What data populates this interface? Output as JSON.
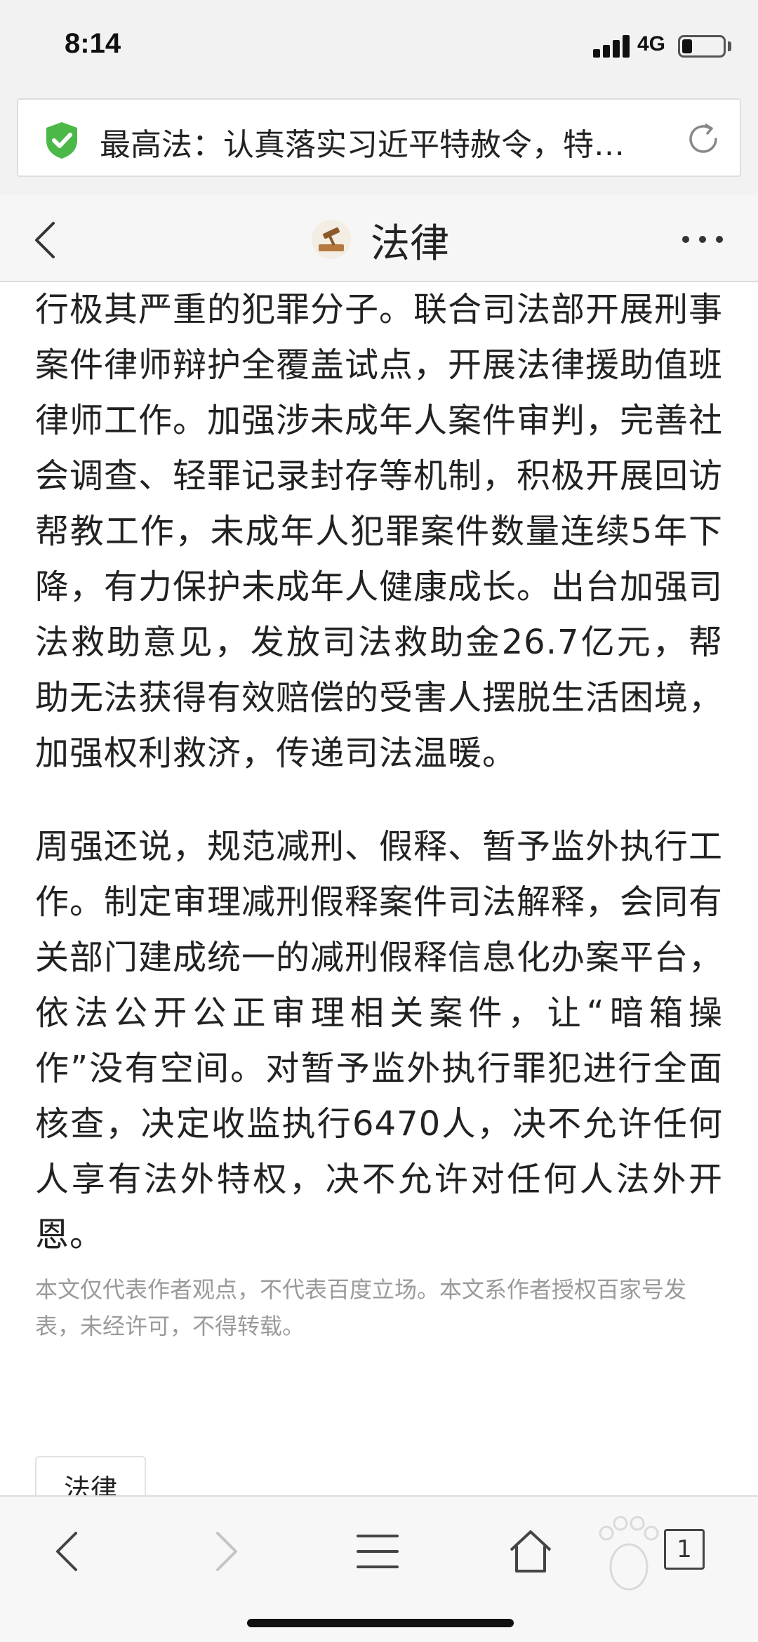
{
  "status": {
    "time": "8:14",
    "network": "4G"
  },
  "address_bar": {
    "text": "最高法：认真落实习近平特赦令，特…"
  },
  "header": {
    "title": "法律"
  },
  "article": {
    "paragraphs": [
      "行极其严重的犯罪分子。联合司法部开展刑事案件律师辩护全覆盖试点，开展法律援助值班律师工作。加强涉未成年人案件审判，完善社会调查、轻罪记录封存等机制，积极开展回访帮教工作，未成年人犯罪案件数量连续5年下降，有力保护未成年人健康成长。出台加强司法救助意见，发放司法救助金26.7亿元，帮助无法获得有效赔偿的受害人摆脱生活困境，加强权利救济，传递司法温暖。",
      "周强还说，规范减刑、假释、暂予监外执行工作。制定审理减刑假释案件司法解释，会同有关部门建成统一的减刑假释信息化办案平台，依法公开公正审理相关案件，让“暗箱操作”没有空间。对暂予监外执行罪犯进行全面核查，决定收监执行6470人，决不允许任何人享有法外特权，决不允许对任何人法外开恩。"
    ],
    "disclaimer": "本文仅代表作者观点，不代表百度立场。本文系作者授权百家号发表，未经许可，不得转载。",
    "tag": "法律"
  },
  "toolbar": {
    "tab_count": "1"
  },
  "colors": {
    "shield_green": "#4cb848",
    "page_bg": "#ffffff",
    "bar_bg": "#f2f2f2"
  },
  "icons": [
    "shield-check-icon",
    "reload-icon",
    "back-chevron-icon",
    "law-logo-icon",
    "more-dots-icon",
    "back-icon",
    "forward-icon",
    "menu-icon",
    "home-icon",
    "paw-icon",
    "tabs-icon"
  ]
}
